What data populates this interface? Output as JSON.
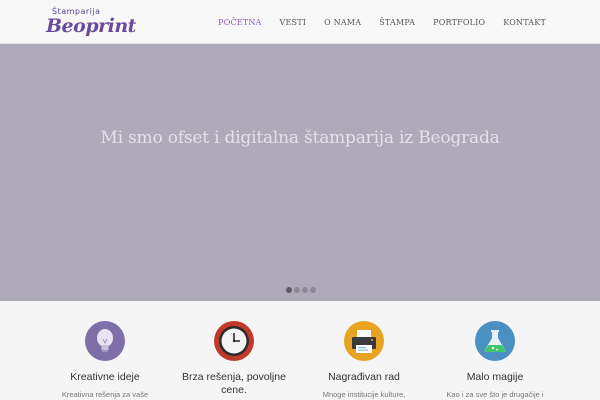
{
  "header": {
    "logo_top": "Štamparija",
    "logo_main": "Beoprint",
    "nav": [
      {
        "label": "POČETNA",
        "active": true
      },
      {
        "label": "VESTI",
        "active": false
      },
      {
        "label": "O NAMA",
        "active": false
      },
      {
        "label": "ŠTAMPA",
        "active": false
      },
      {
        "label": "PORTFOLIO",
        "active": false
      },
      {
        "label": "KONTAKT",
        "active": false
      }
    ]
  },
  "hero": {
    "headline": "Mi smo ofset i digitalna štamparija iz Beograda",
    "slides_total": 4,
    "active_slide": 1
  },
  "features": [
    {
      "icon": "lightbulb-icon",
      "title": "Kreativne ideje",
      "text": "Kreativna rešenja za vaše",
      "color": "#7f6fa8"
    },
    {
      "icon": "clock-icon",
      "title": "Brza rešenja, povoljne cene.",
      "text": "",
      "color": "#c0392b"
    },
    {
      "icon": "printer-icon",
      "title": "Nagrađivan rad",
      "text": "Mnoge institucije kulture,",
      "color": "#e8a321"
    },
    {
      "icon": "flask-icon",
      "title": "Malo magije",
      "text": "Kao i za sve što je drugačije i",
      "color": "#4a90c2"
    }
  ],
  "colors": {
    "accent": "#8a5cb8",
    "hero_bg": "#aeaab7"
  }
}
